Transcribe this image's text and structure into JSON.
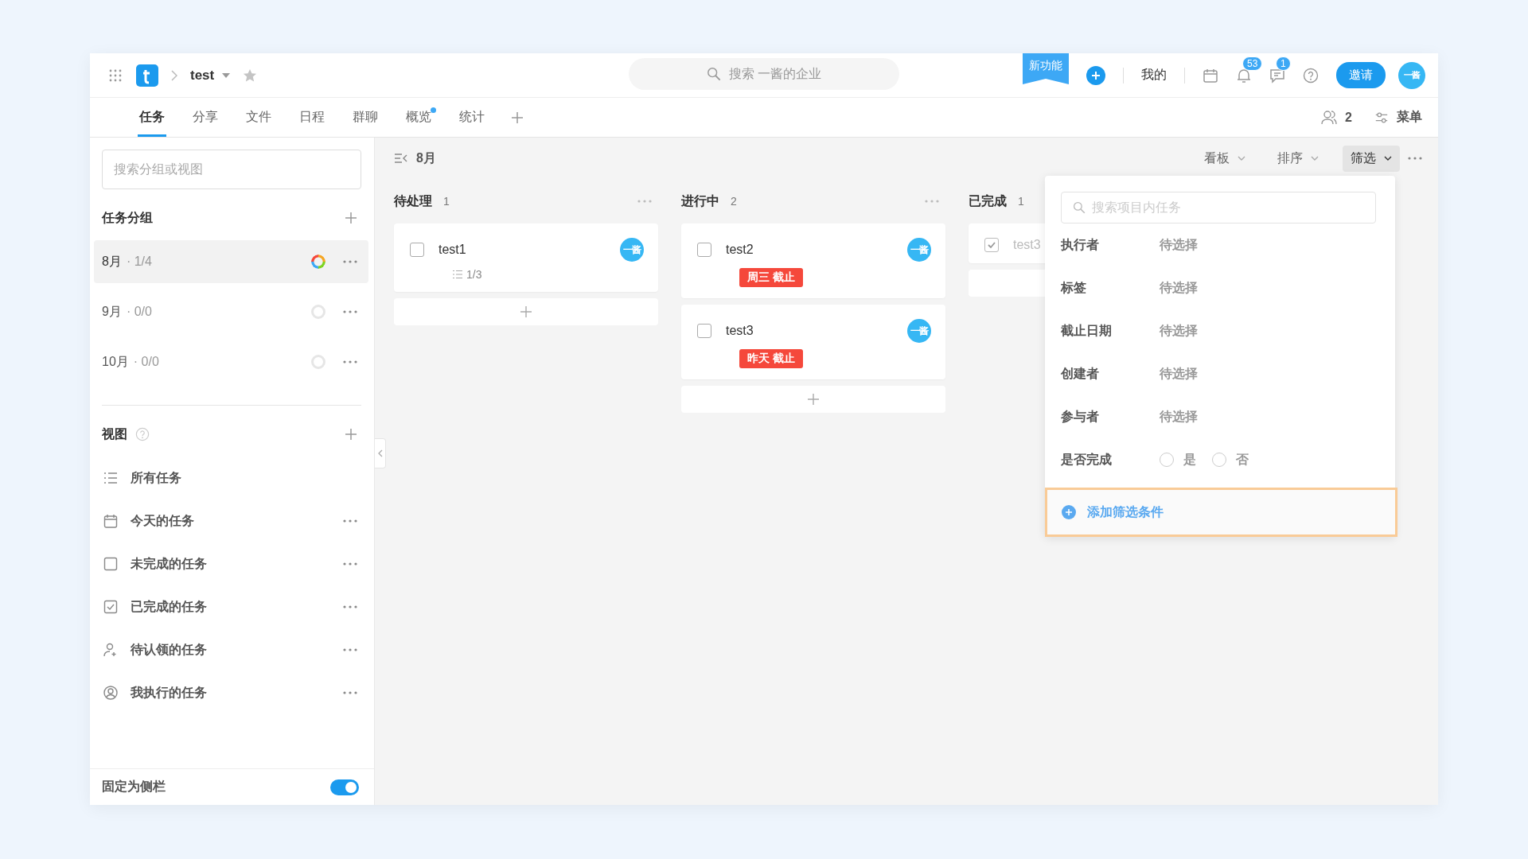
{
  "top_bar": {
    "project": "test",
    "search_placeholder": "搜索 一酱的企业",
    "new_feature_ribbon": "新功能",
    "my_label": "我的",
    "notifications_badge": "53",
    "messages_badge": "1",
    "invite_button": "邀请",
    "avatar": "一酱"
  },
  "tabs": [
    {
      "label": "任务",
      "selected": true,
      "dot": false
    },
    {
      "label": "分享",
      "selected": false,
      "dot": false
    },
    {
      "label": "文件",
      "selected": false,
      "dot": false
    },
    {
      "label": "日程",
      "selected": false,
      "dot": false
    },
    {
      "label": "群聊",
      "selected": false,
      "dot": false
    },
    {
      "label": "概览",
      "selected": false,
      "dot": true
    },
    {
      "label": "统计",
      "selected": false,
      "dot": false
    }
  ],
  "tab_bar_right": {
    "members_count": "2",
    "menu_label": "菜单"
  },
  "sidebar": {
    "search_placeholder": "搜索分组或视图",
    "groups_title": "任务分组",
    "groups": [
      {
        "name": "8月",
        "progress": "· 1/4",
        "selected": true,
        "active": true
      },
      {
        "name": "9月",
        "progress": "· 0/0",
        "selected": false,
        "active": false
      },
      {
        "name": "10月",
        "progress": "· 0/0",
        "selected": false,
        "active": false
      }
    ],
    "views_title": "视图",
    "views": [
      {
        "label": "所有任务",
        "kind": "list",
        "has_menu": false
      },
      {
        "label": "今天的任务",
        "kind": "calendar",
        "has_menu": true
      },
      {
        "label": "未完成的任务",
        "kind": "open",
        "has_menu": true
      },
      {
        "label": "已完成的任务",
        "kind": "done",
        "has_menu": true
      },
      {
        "label": "待认领的任务",
        "kind": "unclaimed",
        "has_menu": true
      },
      {
        "label": "我执行的任务",
        "kind": "mine",
        "has_menu": true
      }
    ],
    "pin_label": "固定为侧栏",
    "pin_on": true
  },
  "board": {
    "title": "8月",
    "toolbar": [
      {
        "label": "看板",
        "selected": false
      },
      {
        "label": "排序",
        "selected": false
      },
      {
        "label": "筛选",
        "selected": true
      }
    ],
    "columns": [
      {
        "title": "待处理",
        "count": "1",
        "show_menu": true,
        "add_icon_visible": true,
        "cards": [
          {
            "title": "test1",
            "done": false,
            "avatar": "一酱",
            "subtasks": "1/3"
          }
        ]
      },
      {
        "title": "进行中",
        "count": "2",
        "show_menu": true,
        "add_icon_visible": true,
        "cards": [
          {
            "title": "test2",
            "done": false,
            "avatar": "一酱",
            "tag": "周三 截止"
          },
          {
            "title": "test3",
            "done": false,
            "avatar": "一酱",
            "tag": "昨天 截止"
          }
        ]
      },
      {
        "title": "已完成",
        "count": "1",
        "show_menu": false,
        "add_icon_visible": false,
        "cards": [
          {
            "title": "test3",
            "done": true
          }
        ]
      }
    ]
  },
  "filter_panel": {
    "search_placeholder": "搜索项目内任务",
    "fields": [
      {
        "label": "执行者",
        "kind": "select",
        "value_placeholder": "待选择"
      },
      {
        "label": "标签",
        "kind": "select",
        "value_placeholder": "待选择"
      },
      {
        "label": "截止日期",
        "kind": "select",
        "value_placeholder": "待选择"
      },
      {
        "label": "创建者",
        "kind": "select",
        "value_placeholder": "待选择"
      },
      {
        "label": "参与者",
        "kind": "select",
        "value_placeholder": "待选择"
      },
      {
        "label": "是否完成",
        "kind": "radio",
        "options": [
          {
            "label": "是",
            "selected": false
          },
          {
            "label": "否",
            "selected": false
          }
        ]
      }
    ],
    "add_condition": "添加筛选条件"
  }
}
